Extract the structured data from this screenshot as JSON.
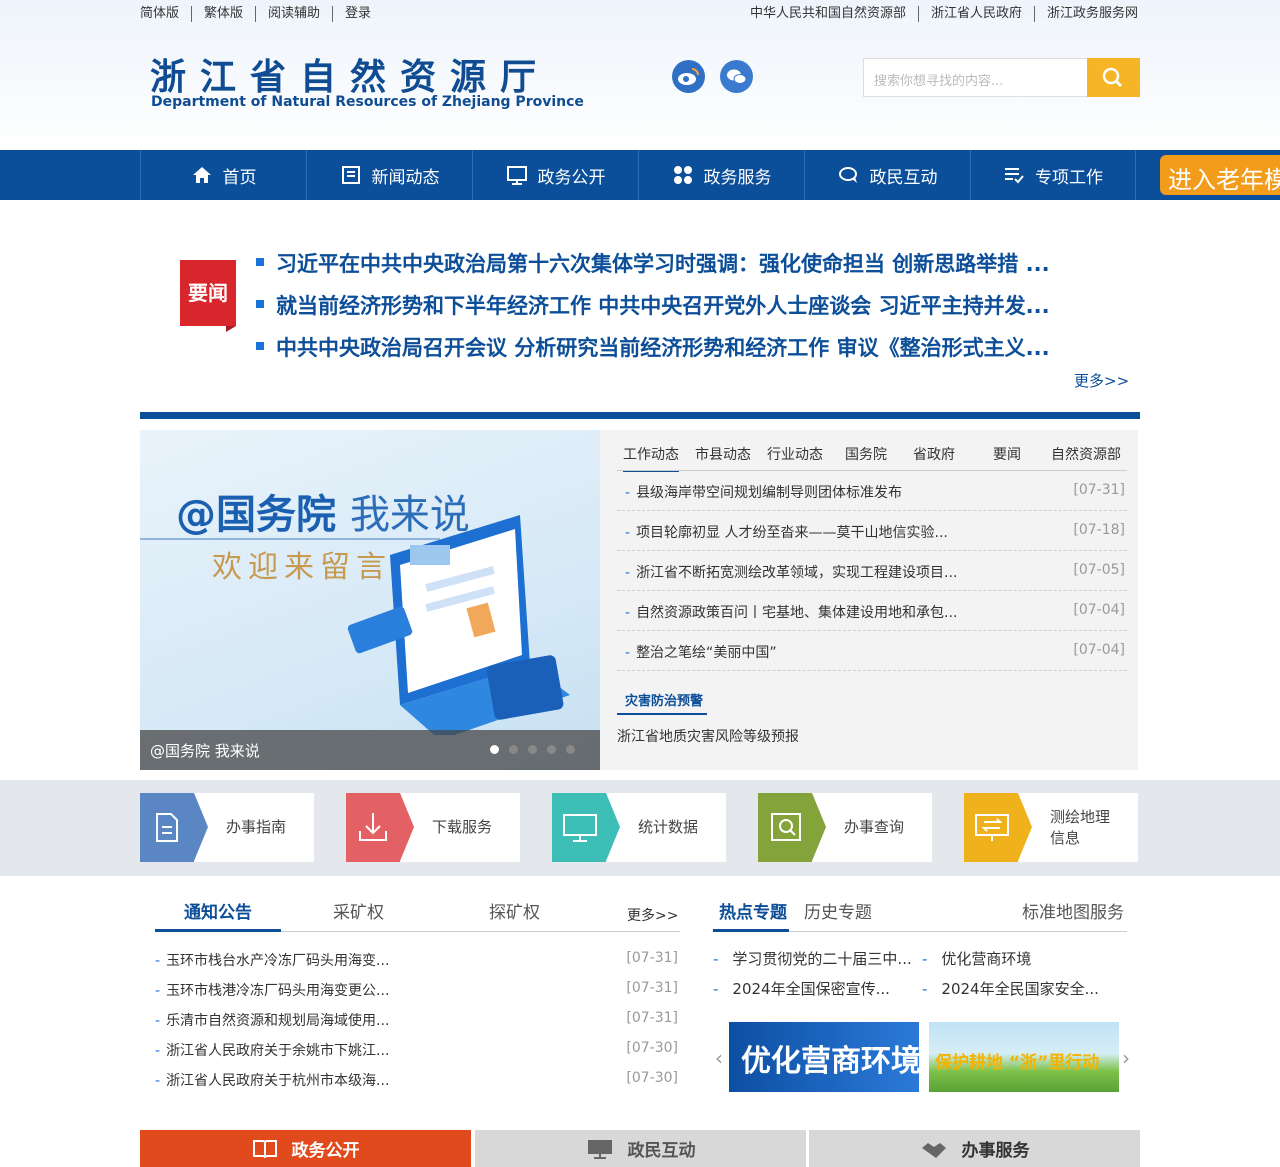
{
  "top_left_links": [
    "简体版",
    "繁体版",
    "阅读辅助",
    "登录"
  ],
  "top_right_links": [
    "中华人民共和国自然资源部",
    "浙江省人民政府",
    "浙江政务服务网"
  ],
  "site": {
    "title_cn": "浙江省自然资源厅",
    "title_en": "Department of Natural Resources of Zhejiang Province"
  },
  "search": {
    "placeholder": "搜索你想寻找的内容..."
  },
  "nav": [
    "首页",
    "新闻动态",
    "政务公开",
    "政务服务",
    "政民互动",
    "专项工作"
  ],
  "elder_mode": "进入老年模式",
  "headlines": {
    "badge": "要闻",
    "items": [
      "习近平在中共中央政治局第十六次集体学习时强调：强化使命担当 创新思路举措 ...",
      "就当前经济形势和下半年经济工作 中共中央召开党外人士座谈会 习近平主持并发...",
      "中共中央政治局召开会议 分析研究当前经济形势和经济工作 审议《整治形式主义..."
    ],
    "more": "更多>>"
  },
  "banner": {
    "line1_bold": "@国务院",
    "line1_light": "我来说",
    "line2": "欢迎来留言",
    "caption": "@国务院 我来说"
  },
  "news_tabs": [
    "工作动态",
    "市县动态",
    "行业动态",
    "国务院",
    "省政府",
    "要闻",
    "自然资源部"
  ],
  "news_items": [
    {
      "title": "县级海岸带空间规划编制导则团体标准发布",
      "date": "[07-31]"
    },
    {
      "title": "项目轮廓初显 人才纷至沓来——莫干山地信实验...",
      "date": "[07-18]"
    },
    {
      "title": "浙江省不断拓宽测绘改革领域，实现工程建设项目...",
      "date": "[07-05]"
    },
    {
      "title": "自然资源政策百问丨宅基地、集体建设用地和承包...",
      "date": "[07-04]"
    },
    {
      "title": "整治之笔绘“美丽中国”",
      "date": "[07-04]"
    }
  ],
  "disaster": {
    "title": "灾害防治预警",
    "text": "浙江省地质灾害风险等级预报"
  },
  "services": [
    {
      "label": "办事指南",
      "color": "#5b86c4"
    },
    {
      "label": "下载服务",
      "color": "#e36065"
    },
    {
      "label": "统计数据",
      "color": "#3cbdb6"
    },
    {
      "label": "办事查询",
      "color": "#84a33a"
    },
    {
      "label": "测绘地理信息",
      "color": "#efb21d"
    }
  ],
  "notice_tabs": [
    "通知公告",
    "采矿权",
    "探矿权"
  ],
  "notice_more": "更多>>",
  "notices": [
    {
      "title": "玉环市栈台水产冷冻厂码头用海变...",
      "date": "[07-31]"
    },
    {
      "title": "玉环市栈港冷冻厂码头用海变更公...",
      "date": "[07-31]"
    },
    {
      "title": "乐清市自然资源和规划局海域使用...",
      "date": "[07-31]"
    },
    {
      "title": "浙江省人民政府关于余姚市下姚江...",
      "date": "[07-30]"
    },
    {
      "title": "浙江省人民政府关于杭州市本级海...",
      "date": "[07-30]"
    }
  ],
  "topic_tabs": [
    "热点专题",
    "历史专题",
    "标准地图服务"
  ],
  "topics": [
    "学习贯彻党的二十届三中...",
    "优化营商环境",
    "2024年全国保密宣传...",
    "2024年全民国家安全..."
  ],
  "promos": [
    "优化营商环境",
    "保护耕地 “浙”里行动"
  ],
  "bottom_tabs": [
    "政务公开",
    "政民互动",
    "办事服务"
  ]
}
